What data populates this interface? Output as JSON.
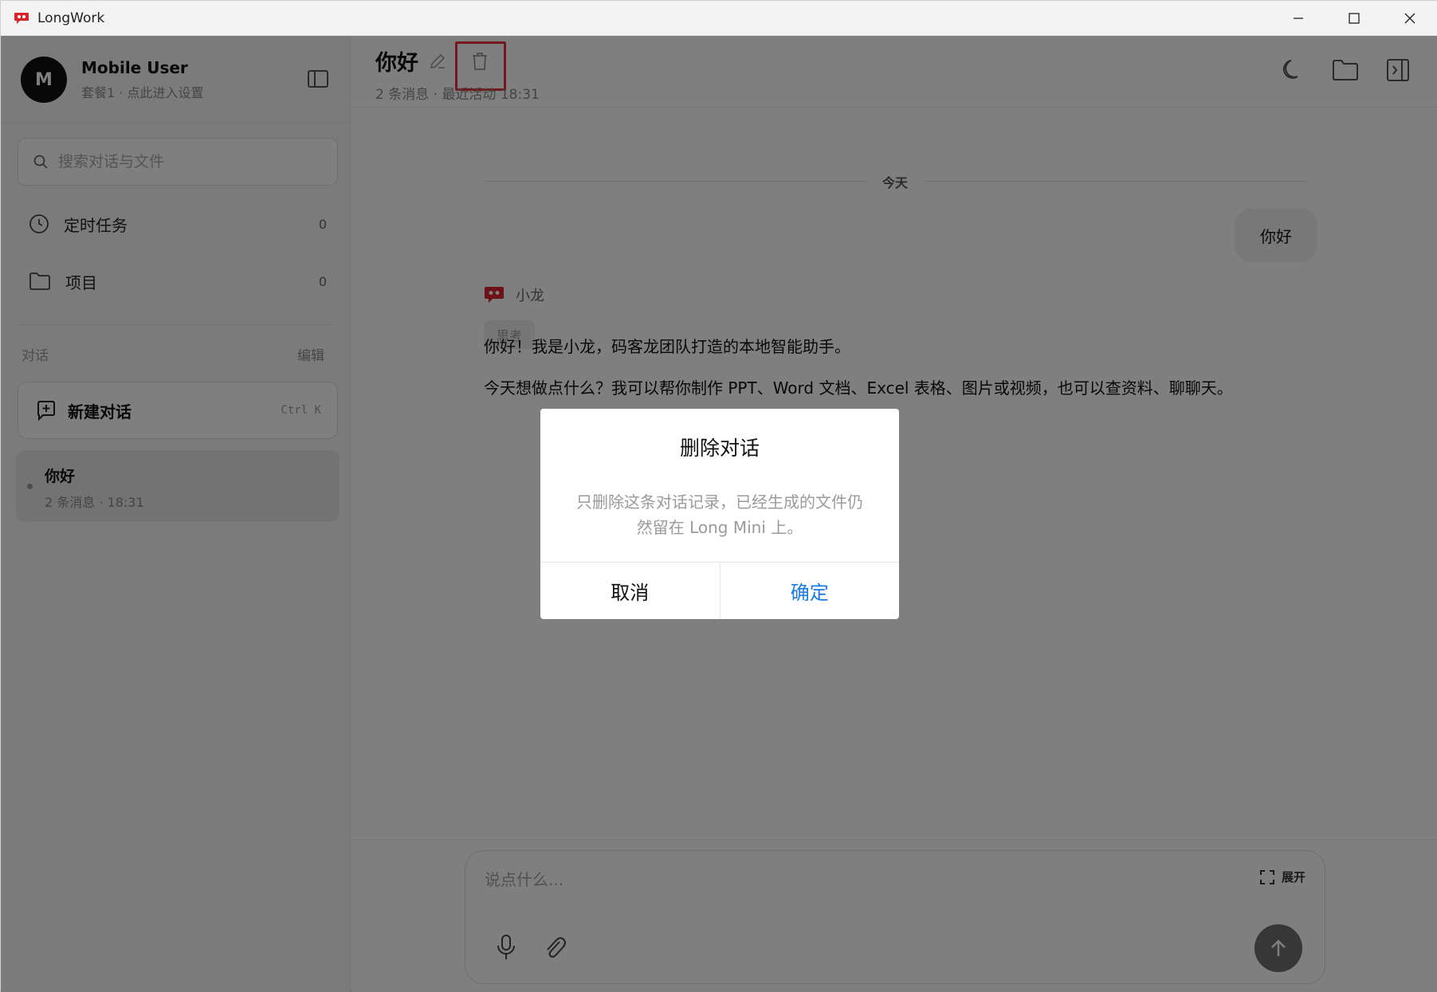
{
  "window": {
    "title": "LongWork",
    "controls": [
      "minimize",
      "maximize",
      "close"
    ]
  },
  "sidebar": {
    "user": {
      "avatar_letter": "M",
      "name": "Mobile User",
      "subtitle": "套餐1 · 点此进入设置"
    },
    "search": {
      "placeholder": "搜索对话与文件"
    },
    "nav": [
      {
        "label": "定时任务",
        "count": "0",
        "icon": "clock-icon"
      },
      {
        "label": "项目",
        "count": "0",
        "icon": "folder-icon"
      }
    ],
    "section": {
      "title": "对话",
      "edit_label": "编辑"
    },
    "new_chat": {
      "label": "新建对话",
      "shortcut": "Ctrl K"
    },
    "conversations": [
      {
        "title": "你好",
        "meta": "2 条消息 · 18:31"
      }
    ]
  },
  "main": {
    "header": {
      "title": "你好",
      "meta": "2 条消息 · 最近活动 18:31",
      "icons": [
        "moon-icon",
        "folder-icon",
        "panel-right-icon"
      ]
    },
    "day_separator": "今天",
    "messages": {
      "user": "你好",
      "bot_name": "小龙",
      "think_label": "思考",
      "bot_lines": [
        "你好！我是小龙，码客龙团队打造的本地智能助手。",
        "今天想做点什么？我可以帮你制作 PPT、Word 文档、Excel 表格、图片或视频，也可以查资料、聊聊天。"
      ]
    },
    "composer": {
      "placeholder": "说点什么...",
      "expand_label": "展开"
    }
  },
  "dialog": {
    "title": "删除对话",
    "body": "只删除这条对话记录，已经生成的文件仍然留在 Long Mini 上。",
    "cancel_label": "取消",
    "confirm_label": "确定"
  },
  "colors": {
    "accent_blue": "#1a7be0",
    "highlight_red": "#e8313a",
    "brand_red": "#d8232a"
  }
}
